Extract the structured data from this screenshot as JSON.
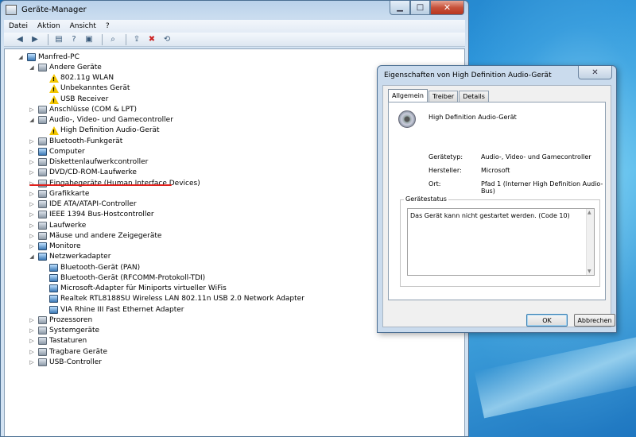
{
  "window": {
    "title": "Geräte-Manager",
    "menu": [
      "Datei",
      "Aktion",
      "Ansicht",
      "?"
    ],
    "min_label": "▁",
    "max_label": "□",
    "close_label": "✕"
  },
  "toolbar": [
    "back-icon",
    "forward-icon",
    "properties-icon",
    "help-icon",
    "show-icon",
    "scan-icon",
    "update-driver-icon",
    "disable-icon",
    "uninstall-icon"
  ],
  "tree": {
    "root": "Manfred-PC",
    "items": [
      {
        "label": "Andere Geräte",
        "level": 1,
        "expander": "◢",
        "icon": "device-icon"
      },
      {
        "label": "802.11g WLAN",
        "level": 2,
        "expander": "",
        "icon": "warning-icon"
      },
      {
        "label": "Unbekanntes Gerät",
        "level": 2,
        "expander": "",
        "icon": "warning-icon"
      },
      {
        "label": "USB Receiver",
        "level": 2,
        "expander": "",
        "icon": "warning-icon"
      },
      {
        "label": "Anschlüsse (COM & LPT)",
        "level": 1,
        "expander": "▷",
        "icon": "port-icon"
      },
      {
        "label": "Audio-, Video- und Gamecontroller",
        "level": 1,
        "expander": "◢",
        "icon": "audio-icon"
      },
      {
        "label": "High Definition Audio-Gerät",
        "level": 2,
        "expander": "",
        "icon": "warning-icon"
      },
      {
        "label": "Bluetooth-Funkgerät",
        "level": 1,
        "expander": "▷",
        "icon": "bluetooth-icon"
      },
      {
        "label": "Computer",
        "level": 1,
        "expander": "▷",
        "icon": "computer-icon"
      },
      {
        "label": "Diskettenlaufwerkcontroller",
        "level": 1,
        "expander": "▷",
        "icon": "floppy-controller-icon"
      },
      {
        "label": "DVD/CD-ROM-Laufwerke",
        "level": 1,
        "expander": "▷",
        "icon": "dvd-icon"
      },
      {
        "label": "Eingabegeräte (Human Interface Devices)",
        "level": 1,
        "expander": "▷",
        "icon": "hid-icon"
      },
      {
        "label": "Grafikkarte",
        "level": 1,
        "expander": "▷",
        "icon": "display-adapter-icon"
      },
      {
        "label": "IDE ATA/ATAPI-Controller",
        "level": 1,
        "expander": "▷",
        "icon": "ide-icon"
      },
      {
        "label": "IEEE 1394 Bus-Hostcontroller",
        "level": 1,
        "expander": "▷",
        "icon": "firewire-icon"
      },
      {
        "label": "Laufwerke",
        "level": 1,
        "expander": "▷",
        "icon": "drive-icon"
      },
      {
        "label": "Mäuse und andere Zeigegeräte",
        "level": 1,
        "expander": "▷",
        "icon": "mouse-icon"
      },
      {
        "label": "Monitore",
        "level": 1,
        "expander": "▷",
        "icon": "monitor-icon"
      },
      {
        "label": "Netzwerkadapter",
        "level": 1,
        "expander": "◢",
        "icon": "network-icon"
      },
      {
        "label": "Bluetooth-Gerät (PAN)",
        "level": 2,
        "expander": "",
        "icon": "network-icon"
      },
      {
        "label": "Bluetooth-Gerät (RFCOMM-Protokoll-TDI)",
        "level": 2,
        "expander": "",
        "icon": "network-icon"
      },
      {
        "label": "Microsoft-Adapter für Miniports virtueller WiFis",
        "level": 2,
        "expander": "",
        "icon": "network-icon"
      },
      {
        "label": "Realtek RTL8188SU Wireless LAN 802.11n USB 2.0 Network Adapter",
        "level": 2,
        "expander": "",
        "icon": "network-icon"
      },
      {
        "label": "VIA Rhine III Fast Ethernet Adapter",
        "level": 2,
        "expander": "",
        "icon": "network-icon"
      },
      {
        "label": "Prozessoren",
        "level": 1,
        "expander": "▷",
        "icon": "processor-icon"
      },
      {
        "label": "Systemgeräte",
        "level": 1,
        "expander": "▷",
        "icon": "system-icon"
      },
      {
        "label": "Tastaturen",
        "level": 1,
        "expander": "▷",
        "icon": "keyboard-icon"
      },
      {
        "label": "Tragbare Geräte",
        "level": 1,
        "expander": "▷",
        "icon": "portable-icon"
      },
      {
        "label": "USB-Controller",
        "level": 1,
        "expander": "▷",
        "icon": "usb-icon"
      }
    ]
  },
  "dialog": {
    "title": "Eigenschaften von High Definition Audio-Gerät",
    "close_label": "✕",
    "tabs": [
      "Allgemein",
      "Treiber",
      "Details"
    ],
    "device_name": "High Definition Audio-Gerät",
    "properties": [
      {
        "label": "Gerätetyp:",
        "value": "Audio-, Video- und Gamecontroller"
      },
      {
        "label": "Hersteller:",
        "value": "Microsoft"
      },
      {
        "label": "Ort:",
        "value": "Pfad 1 (Interner High Definition Audio-Bus)"
      }
    ],
    "status_legend": "Gerätestatus",
    "status_text": "Das Gerät kann nicht gestartet werden. (Code 10)",
    "ok_label": "OK",
    "cancel_label": "Abbrechen"
  },
  "colors": {
    "highlight_line": "#e0201c",
    "warning": "#f3c600"
  }
}
